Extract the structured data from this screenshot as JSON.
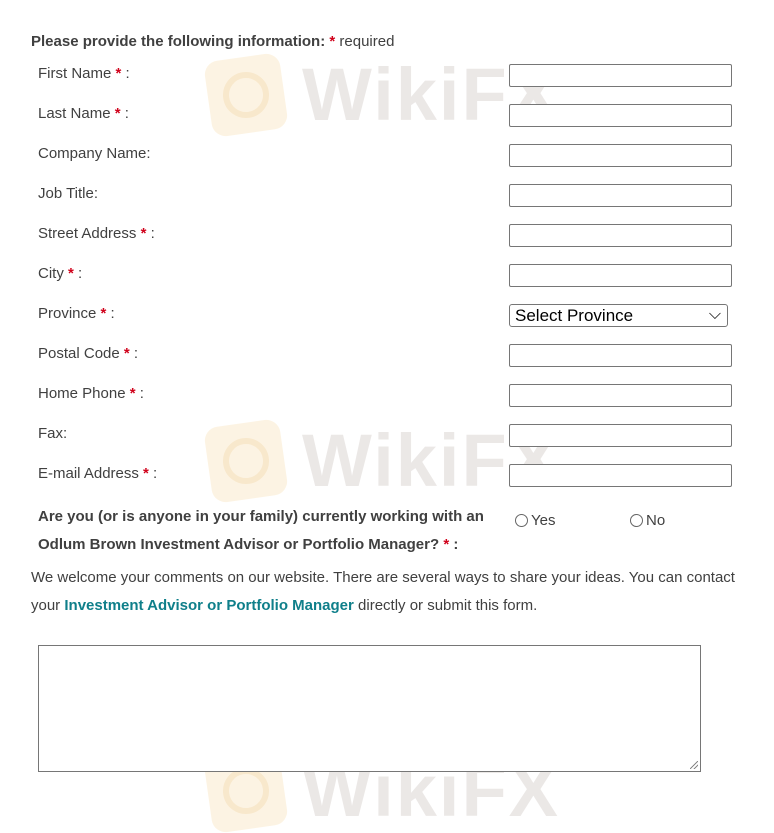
{
  "watermark": {
    "text": "WikiFX"
  },
  "intro": {
    "label": "Please provide the following information:",
    "star": "*",
    "suffix": "required"
  },
  "fields": [
    {
      "label": "First Name",
      "required": true,
      "value": ""
    },
    {
      "label": "Last Name",
      "required": true,
      "value": ""
    },
    {
      "label": "Company Name:",
      "required": false,
      "value": ""
    },
    {
      "label": "Job Title:",
      "required": false,
      "value": ""
    },
    {
      "label": "Street Address",
      "required": true,
      "value": ""
    },
    {
      "label": "City",
      "required": true,
      "value": ""
    },
    {
      "label": "Province",
      "required": true,
      "type": "select",
      "value": "Select Province"
    },
    {
      "label": "Postal Code",
      "required": true,
      "value": ""
    },
    {
      "label": "Home Phone",
      "required": true,
      "value": ""
    },
    {
      "label": "Fax:",
      "required": false,
      "value": ""
    },
    {
      "label": "E-mail Address",
      "required": true,
      "value": ""
    }
  ],
  "question": {
    "text": "Are you (or is anyone in your family) currently working with an Odlum Brown Investment Advisor or Portfolio Manager?",
    "star": "*",
    "colon": ":",
    "options": [
      "Yes",
      "No"
    ]
  },
  "comments": {
    "before": "We welcome your comments on our website. There are several ways to share your ideas. You can contact your",
    "link": "Investment Advisor or Portfolio Manager",
    "after": "directly or submit this form."
  },
  "colors": {
    "required": "#d0021b",
    "link": "#0f7f8a",
    "text": "#404040"
  },
  "icons": {
    "select_arrow": "chevron-down-icon",
    "radio": "radio-button-icon"
  }
}
